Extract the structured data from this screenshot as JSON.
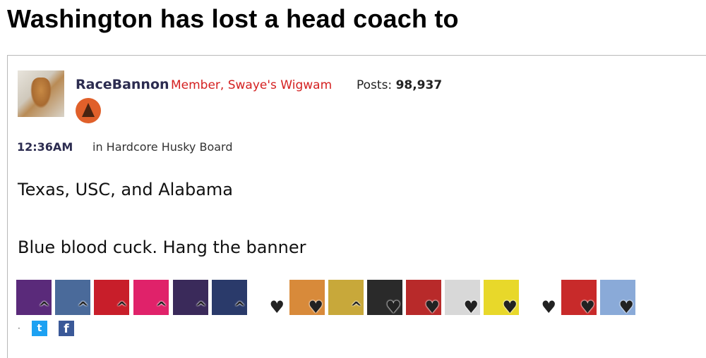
{
  "thread": {
    "title": "Washington has lost a head coach to"
  },
  "post": {
    "author": "RaceBannon",
    "role": "Member, Swaye's Wigwam",
    "posts_label": "Posts:",
    "posts_count": "98,937",
    "time": "12:36AM",
    "category": "in Hardcore Husky Board",
    "body": [
      "Texas, USC, and Alabama",
      "Blue blood cuck. Hang the banner"
    ]
  },
  "reactions": [
    {
      "icon": "purple-crown-reaction-icon",
      "overlay": "^",
      "color": "#5a2a7a"
    },
    {
      "icon": "masked-face-reaction-icon",
      "overlay": "^",
      "color": "#4a6a9a"
    },
    {
      "icon": "red-stripes-reaction-icon",
      "overlay": "^",
      "color": "#c81e2a"
    },
    {
      "icon": "green-circle-reaction-icon",
      "overlay": "^",
      "color": "#e0226a"
    },
    {
      "icon": "purple-crowd-reaction-icon",
      "overlay": "^",
      "color": "#3a2a5a"
    },
    {
      "icon": "stadium-scoreboard-reaction-icon",
      "overlay": "^",
      "color": "#2a3a6a"
    },
    {
      "icon": "fpa-text-reaction-icon",
      "overlay": "♥",
      "color": "#ffffff"
    },
    {
      "icon": "cum-sign-reaction-icon",
      "overlay": "♥",
      "color": "#d88a3a"
    },
    {
      "icon": "pineapple-reaction-icon",
      "overlay": "^",
      "color": "#c8a83a"
    },
    {
      "icon": "lei-man-reaction-icon",
      "overlay": "♥",
      "color": "#2a2a2a"
    },
    {
      "icon": "protest-sign-reaction-icon",
      "overlay": "♥",
      "color": "#b82a2a"
    },
    {
      "icon": "i-heart-sign-reaction-icon",
      "overlay": "♥",
      "color": "#d8d8d8"
    },
    {
      "icon": "yellow-portrait-reaction-icon",
      "overlay": "♥",
      "color": "#e8d82a"
    },
    {
      "icon": "plain-heart-reaction-icon",
      "overlay": "♥",
      "color": "#ffffff"
    },
    {
      "icon": "red-flag-reaction-icon",
      "overlay": "♥",
      "color": "#c82a2a"
    },
    {
      "icon": "sky-field-reaction-icon",
      "overlay": "♥",
      "color": "#8aaad8"
    }
  ],
  "share": {
    "twitter_glyph": "t",
    "facebook_glyph": "f",
    "separator": "·"
  }
}
